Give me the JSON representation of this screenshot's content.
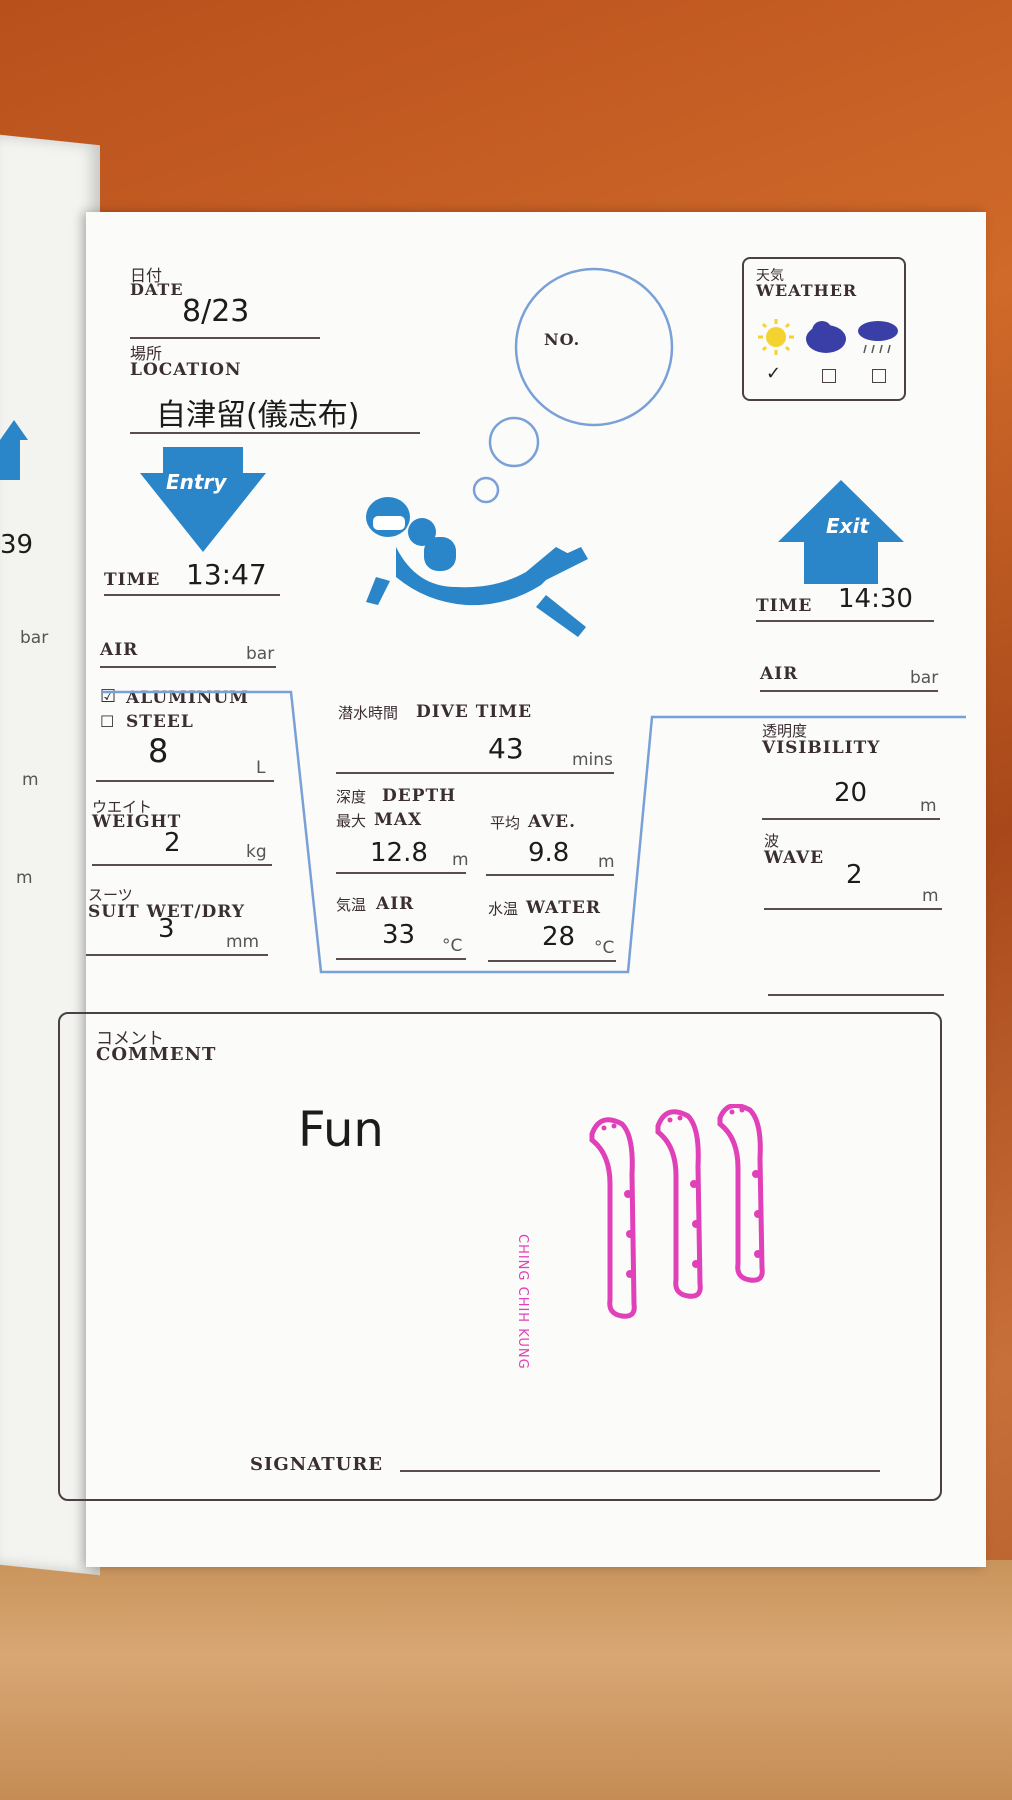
{
  "header": {
    "date_jp": "日付",
    "date_label": "DATE",
    "date_value": "8/23",
    "location_jp": "場所",
    "location_label": "LOCATION",
    "location_value": "自津留(儀志布)",
    "no_label": "NO."
  },
  "weather": {
    "jp": "天気",
    "label": "WEATHER",
    "checked": "✓"
  },
  "entry": {
    "arrow_label": "Entry",
    "time_label": "TIME",
    "time_value": "13:47",
    "air_label": "AIR",
    "air_unit": "bar",
    "aluminum_mark": "☑",
    "aluminum_label": "ALUMINUM",
    "steel_mark": "☐",
    "steel_label": "STEEL",
    "tank_value": "8",
    "tank_unit": "L",
    "weight_jp": "ウエイト",
    "weight_label": "WEIGHT",
    "weight_value": "2",
    "weight_unit": "kg",
    "suit_jp": "スーツ",
    "suit_label": "SUIT WET/DRY",
    "suit_value": "3",
    "suit_unit": "mm"
  },
  "dive": {
    "time_jp": "潜水時間",
    "time_label": "DIVE TIME",
    "time_value": "43",
    "time_unit": "mins",
    "depth_jp": "深度",
    "depth_label": "DEPTH",
    "max_jp": "最大",
    "max_label": "MAX",
    "max_value": "12.8",
    "max_unit": "m",
    "ave_jp": "平均",
    "ave_label": "AVE.",
    "ave_value": "9.8",
    "ave_unit": "m",
    "air_jp": "気温",
    "air_label": "AIR",
    "air_value": "33",
    "air_unit": "°C",
    "water_jp": "水温",
    "water_label": "WATER",
    "water_value": "28",
    "water_unit": "°C"
  },
  "exit": {
    "arrow_label": "Exit",
    "time_label": "TIME",
    "time_value": "14:30",
    "air_label": "AIR",
    "air_unit": "bar",
    "visibility_jp": "透明度",
    "visibility_label": "VISIBILITY",
    "visibility_value": "20",
    "visibility_unit": "m",
    "wave_jp": "波",
    "wave_label": "WAVE",
    "wave_value": "2",
    "wave_unit": "m"
  },
  "comment": {
    "jp": "コメント",
    "label": "COMMENT",
    "text": "Fun",
    "stamp_text": "CHING CHIH KUNG",
    "signature_label": "SIGNATURE"
  },
  "prev_page": {
    "time_partial": "39",
    "air_unit": "bar",
    "m1": "m",
    "m2": "m"
  },
  "colors": {
    "accent_blue": "#2a86c9",
    "stamp_pink": "#e040b8",
    "label_dark": "#3a2e33"
  }
}
